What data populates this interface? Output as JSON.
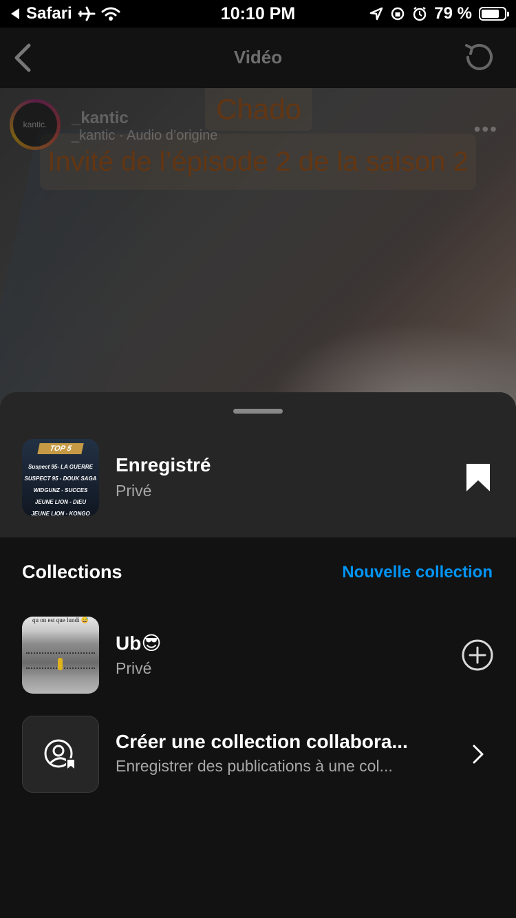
{
  "status_bar": {
    "back_app": "Safari",
    "time": "10:10 PM",
    "battery": "79 %",
    "battery_level": 0.79
  },
  "header": {
    "title": "Vidéo"
  },
  "video": {
    "caption_top": "Chado",
    "caption_main": "Invité de l’épisode 2 de la saison 2",
    "username": "_kantic",
    "subline": "_kantic · Audio d’origine",
    "avatar_text": "kantic."
  },
  "sheet": {
    "saved": {
      "title": "Enregistré",
      "subtitle": "Privé",
      "thumb_badge": "TOP 5",
      "thumb_lines": [
        "Suspect 95- LA GUERRE",
        "SUSPECT 95 - DOUK SAGA",
        "WIDGUNZ - SUCCES",
        "JEUNE LION - DIEU",
        "JEUNE LION - KONGO"
      ]
    },
    "collections_label": "Collections",
    "new_collection_label": "Nouvelle collection",
    "collections": [
      {
        "title": "Ub😎",
        "subtitle": "Privé",
        "thumb_caption": "qu on est que lundi 😅"
      }
    ],
    "collab": {
      "title": "Créer une collection collabora...",
      "subtitle": "Enregistrer des publications à une col..."
    }
  },
  "colors": {
    "accent": "#0095f6",
    "sheet_bg": "#121212",
    "sheet_top_bg": "#262626",
    "muted_text": "#a8a8a8"
  },
  "icons": {
    "back": "chevron-left-icon",
    "refresh": "refresh-icon",
    "bookmark": "bookmark-filled-icon",
    "add": "plus-circle-icon",
    "collab": "collaborative-collection-icon",
    "chevron": "chevron-right-icon"
  }
}
